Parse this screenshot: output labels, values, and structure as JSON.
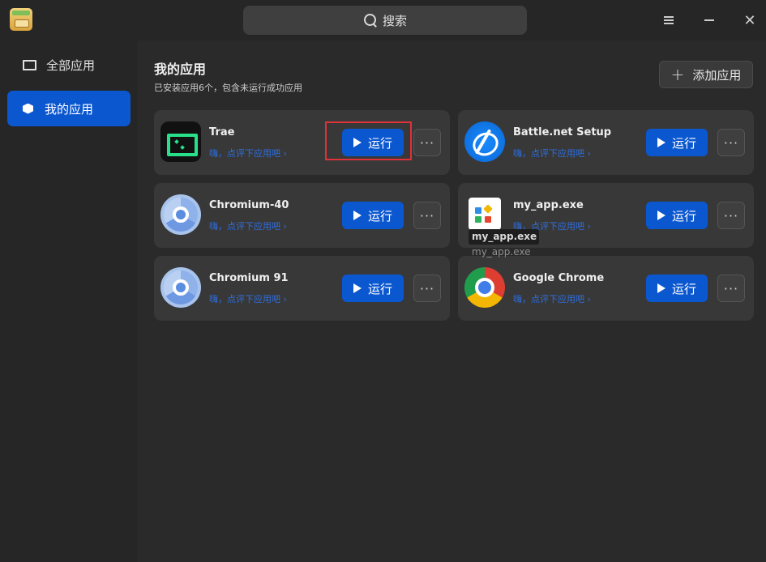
{
  "search": {
    "placeholder": "搜索"
  },
  "sidebar": {
    "items": [
      {
        "label": "全部应用",
        "icon": "monitor-icon"
      },
      {
        "label": "我的应用",
        "icon": "box-icon"
      }
    ]
  },
  "main": {
    "title": "我的应用",
    "subtitle": "已安装应用6个，包含未运行成功应用",
    "add_label": "添加应用",
    "run_label": "运行",
    "more_label": "···",
    "apps": [
      {
        "name": "Trae",
        "hint": "嗨，点评下应用吧 ›",
        "icon": "trae-icon"
      },
      {
        "name": "Battle.net Setup",
        "hint": "嗨，点评下应用吧 ›",
        "icon": "battle-net-icon"
      },
      {
        "name": "Chromium-40",
        "hint": "嗨，点评下应用吧 ›",
        "icon": "chromium-icon"
      },
      {
        "name": "my_app.exe",
        "hint": "嗨，点评下应用吧 ›",
        "icon": "my-app-icon"
      },
      {
        "name": "Chromium 91",
        "hint": "嗨，点评下应用吧 ›",
        "icon": "chromium-icon"
      },
      {
        "name": "Google Chrome",
        "hint": "嗨，点评下应用吧 ›",
        "icon": "google-chrome-icon"
      }
    ]
  },
  "tooltip": {
    "text": "my_app.exe",
    "shadow_text": "my_app.exe"
  },
  "colors": {
    "accent": "#0b57d0",
    "highlight": "#e0323a",
    "hint": "#2f6fe0"
  }
}
